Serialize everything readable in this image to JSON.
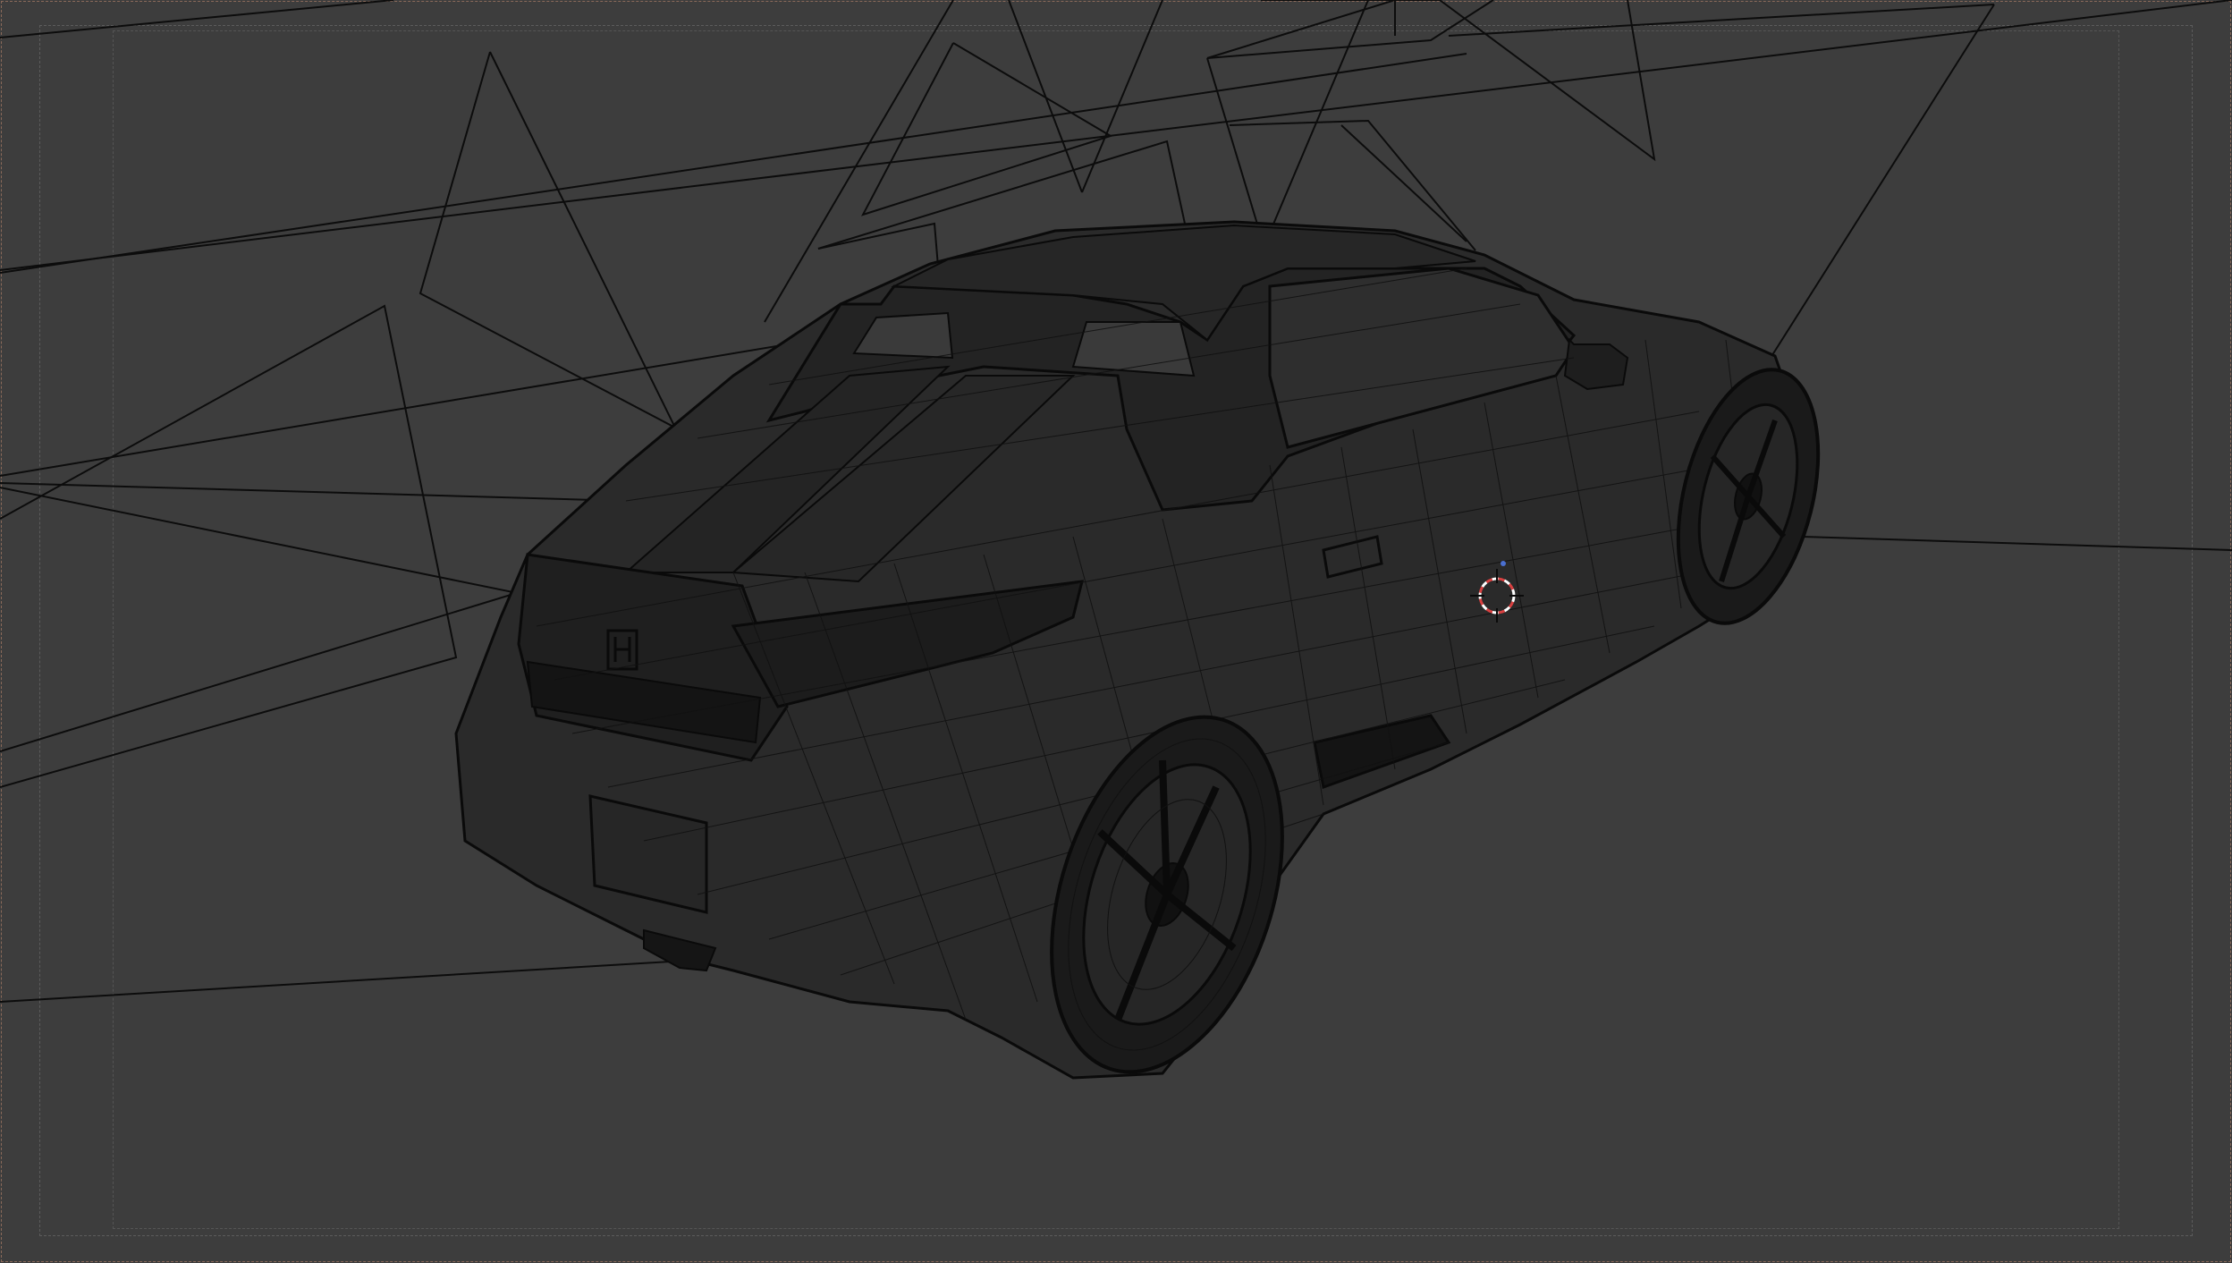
{
  "viewport": {
    "mode": "wireframe",
    "background_color": "#3d3d3d",
    "wire_color": "#0d0d0d",
    "cursor_colors": [
      "#d94040",
      "#ffffff"
    ],
    "icons": {
      "cursor": "3d-cursor-icon",
      "car": "car-wireframe-icon"
    }
  }
}
